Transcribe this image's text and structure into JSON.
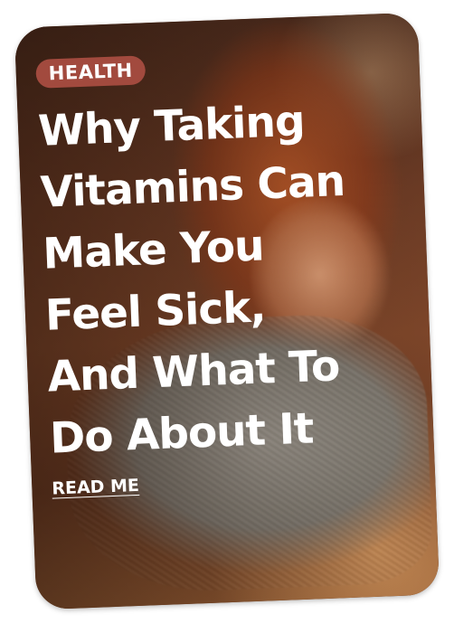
{
  "card": {
    "category": "HEALTH",
    "headline_lines": [
      "Why Taking",
      "Vitamins Can",
      "Make You",
      "Feel Sick,",
      "And What To",
      "Do About It"
    ],
    "cta_label": "READ ME"
  },
  "colors": {
    "tag_background": "#a24a3e",
    "text": "#ffffff"
  }
}
